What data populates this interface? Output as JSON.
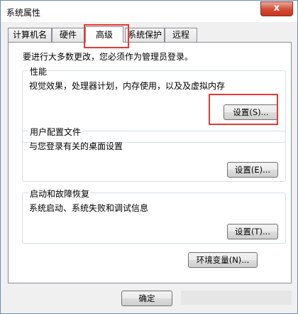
{
  "window": {
    "title": "系统属性",
    "close_label": "x"
  },
  "tabs": [
    {
      "label": "计算机名"
    },
    {
      "label": "硬件"
    },
    {
      "label": "高级"
    },
    {
      "label": "系统保护"
    },
    {
      "label": "远程"
    }
  ],
  "active_tab_index": 2,
  "notice": "要进行大多数更改，您必须作为管理员登录。",
  "performance": {
    "title": "性能",
    "description": "视觉效果，处理器计划，内存使用，以及及虚拟内存",
    "button": "设置(S)..."
  },
  "user_profiles": {
    "title": "用户配置文件",
    "description": "与您登录有关的桌面设置",
    "button": "设置(E)..."
  },
  "startup_recovery": {
    "title": "启动和故障恢复",
    "description": "系统启动、系统失败和调试信息",
    "button": "设置(T)..."
  },
  "env_button": "环境变量(N)...",
  "footer": {
    "ok": "确定"
  },
  "colors": {
    "highlight": "#e53935",
    "border": "#898c95"
  }
}
